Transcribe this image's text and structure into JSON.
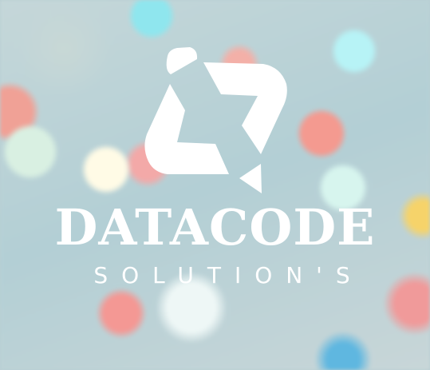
{
  "logo": {
    "icon": "datacode-mark-icon",
    "name": "DATACODE",
    "tagline": "SOLUTION'S",
    "color": "#ffffff"
  }
}
